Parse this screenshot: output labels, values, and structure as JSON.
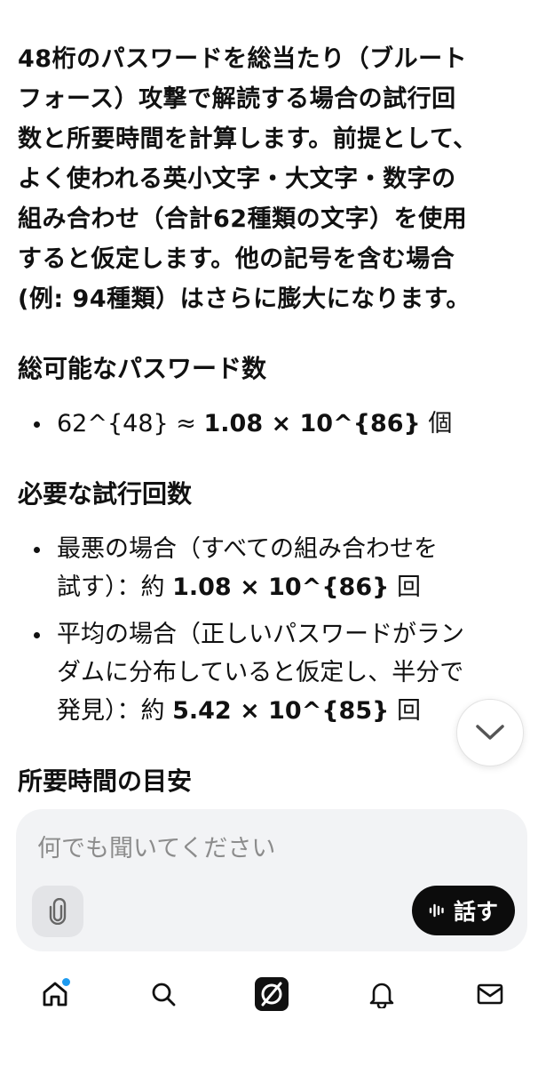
{
  "intro": [
    "48桁のパスワードを総当たり（ブルート",
    "フォース）攻撃で解読する場合の試行回",
    "数と所要時間を計算します。前提として、",
    "よく使われる英小文字・大文字・数字の",
    "組み合わせ（合計62種類の文字）を使用",
    "すると仮定します。他の記号を含む場合",
    "(例: 94種類）はさらに膨大になります。"
  ],
  "section_total": {
    "heading": "総可能なパスワード数",
    "item": {
      "pre": "62^{48} ≈ ",
      "bold": "1.08 × 10^{86}",
      "post": " 個"
    }
  },
  "section_trials": {
    "heading": "必要な試行回数",
    "items": [
      {
        "lines": [
          "最悪の場合（すべての組み合わせを",
          "試す）：約 "
        ],
        "bold": "1.08 × 10^{86}",
        "post": " 回"
      },
      {
        "lines": [
          "平均の場合（正しいパスワードがラン",
          "ダムに分布していると仮定し、半分で",
          "発見）：約 "
        ],
        "bold": "5.42 × 10^{85}",
        "post": " 回"
      }
    ]
  },
  "section_time": {
    "heading": "所要時間の目安"
  },
  "composer": {
    "placeholder": "何でも聞いてください",
    "talk_label": "話す"
  },
  "colors": {
    "text": "#111111",
    "composer_bg": "#f2f3f5",
    "talk_bg": "#0c0c0c",
    "notification_dot": "#1d9bf0"
  },
  "icons": {
    "scroll": "chevron-down-icon",
    "attach": "paperclip-icon",
    "talk": "waveform-icon",
    "nav": [
      "home-icon",
      "search-icon",
      "grok-icon",
      "bell-icon",
      "mail-icon"
    ]
  }
}
